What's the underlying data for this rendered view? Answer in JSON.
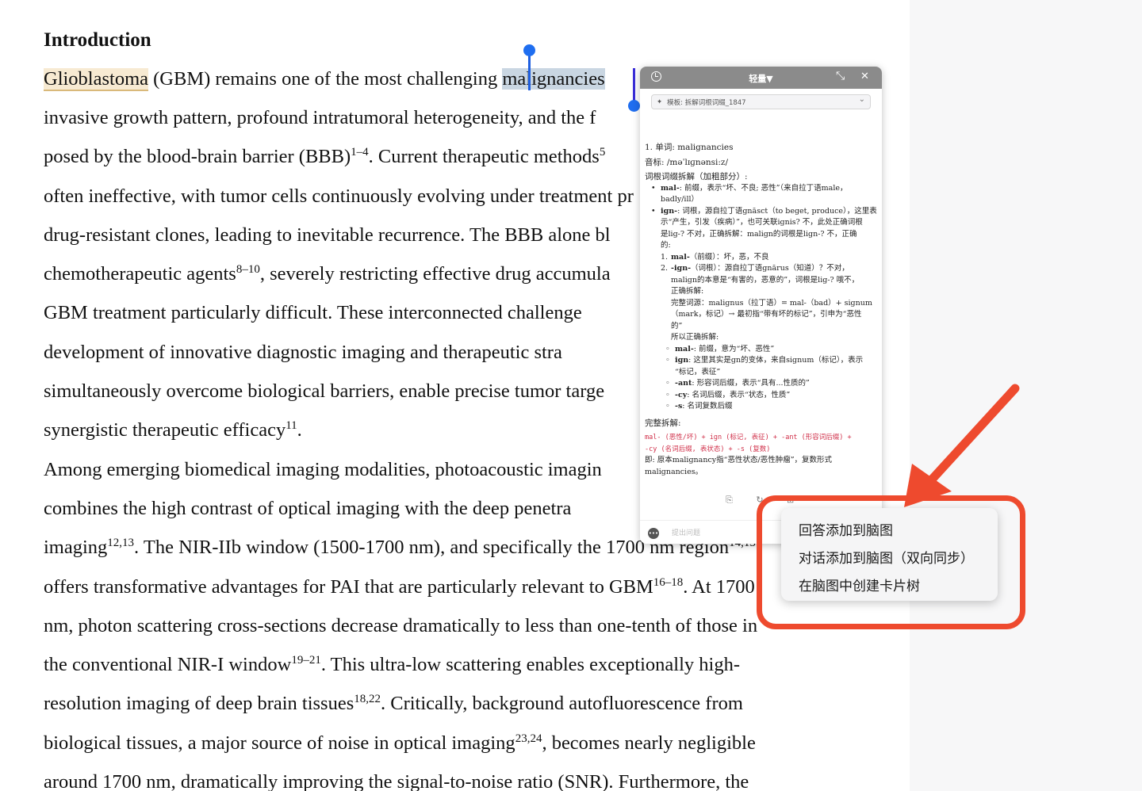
{
  "document": {
    "heading": "Introduction",
    "lines": [
      {
        "pre": "",
        "yellow": "Glioblastoma",
        "text": " (GBM) remains one of the most challenging ",
        "sel": "malignancies"
      },
      {
        "text": "invasive growth pattern, profound intratumoral heterogeneity, and the f"
      },
      {
        "text": "posed by the blood-brain barrier (BBB)",
        "sup": "1–4",
        "text2": ". Current therapeutic methods",
        "sup2": "5"
      },
      {
        "text": "often ineffective, with tumor cells continuously evolving under treatment pr"
      },
      {
        "text": "drug-resistant clones, leading to inevitable recurrence. The BBB alone bl"
      },
      {
        "text": "chemotherapeutic agents",
        "sup": "8–10",
        "text2": ", severely restricting effective drug accumula"
      },
      {
        "text": "GBM treatment particularly difficult. These interconnected challenge"
      },
      {
        "text": "development of innovative diagnostic imaging and therapeutic stra"
      },
      {
        "text": "simultaneously overcome biological barriers, enable precise tumor targe"
      },
      {
        "text": "synergistic therapeutic efficacy",
        "sup": "11",
        "text2": "."
      },
      {
        "text": "Among emerging biomedical imaging modalities, photoacoustic imagin"
      },
      {
        "text": "combines the high contrast of optical imaging with the deep penetra"
      },
      {
        "text": "imaging",
        "sup": "12,13",
        "text2": ". The NIR-IIb window (1500-1700 nm), and specifically the 1700 nm region",
        "sup2": "14,15"
      },
      {
        "text": "offers transformative advantages for PAI that are particularly relevant to GBM",
        "sup": "16–18",
        "text2": ". At 1700"
      },
      {
        "text": "nm, photon scattering cross-sections decrease dramatically to less than one-tenth of those in"
      },
      {
        "text": "the conventional NIR-I window",
        "sup": "19–21",
        "text2": ". This ultra-low scattering enables exceptionally high-"
      },
      {
        "text": "resolution imaging of deep brain tissues",
        "sup": "18,22",
        "text2": ". Critically, background autofluorescence from"
      },
      {
        "text": "biological tissues, a major source of noise in optical imaging",
        "sup": "23,24",
        "text2": ", becomes nearly negligible"
      },
      {
        "text": "around 1700 nm, dramatically improving the signal-to-noise ratio (SNR). Furthermore, the"
      }
    ]
  },
  "panel": {
    "title": "轻量▼",
    "template": "模板: 拆解词根词缀_1847",
    "word_line": "1. 单词:  malignancies",
    "phonetic": "音标:  /məˈlɪɡnənsi:z/",
    "section_title": "词根词缀拆解（加粗部分）:",
    "b1_head": "mal-",
    "b1_text": ": 前缀，表示“坏、不良; 恶性”（来自拉丁语male，",
    "b1_cont": "badly/ill）",
    "b2_head": "ign-",
    "b2_text": ": 词根，源自拉丁语gnāsct（to beget, produce），这里表",
    "b2_cont1": "示“产生，引发（疾病）”，也可关联ignis? 不，此处正确词根",
    "b2_cont2": "是lig-? 不对，正确拆解：malign的词根是lign-? 不，正确",
    "b2_cont3": "的:",
    "n1_head": "mal-",
    "n1_text": "（前缀）：坏，恶，不良",
    "n2_head": "-ign-",
    "n2_text": "（词根）：源自拉丁语gnārus（知道）？不对，",
    "n2_cont1": "malign的本意是“有害的，恶意的”，词根是lig-? 哦不，",
    "n2_cont2": "正确拆解:",
    "n2_cont3": "完整词源：malignus（拉丁语）= mal-（bad）+ signum",
    "n2_cont4": "（mark，标记）→ 最初指“带有坏的标记”，引申为“恶性",
    "n2_cont5": "的”",
    "n2_cont6": "所以正确拆解:",
    "s1_head": "mal-",
    "s1_text": ": 前缀，意为“坏、恶性”",
    "s2_head": "ign",
    "s2_text": ": 这里其实是gn的变体，来自signum（标记），表示",
    "s2_cont": "“标记，表征”",
    "s3_head": "-ant",
    "s3_text": ": 形容词后缀，表示“具有...性质的”",
    "s4_head": "-cy",
    "s4_text": ": 名词后缀，表示“状态，性质”",
    "s5_head": "-s",
    "s5_text": ": 名词复数后缀",
    "full_title": "完整拆解:",
    "code1": "mal- (恶性/坏)  + ign (标记, 表征)  + -ant (形容词后缀)  +",
    "code2": "-cy (名词后缀, 表状态)  + -s (复数)",
    "summary1": "即: 原本malignancy指“恶性状态/恶性肿瘤”，复数形式",
    "summary2": "malignancies。",
    "input_placeholder": "提出问题"
  },
  "context_menu": {
    "items": [
      "回答添加到脑图",
      "对话添加到脑图（双向同步）",
      "在脑图中创建卡片树"
    ]
  },
  "colors": {
    "annotation": "#ee4a2e",
    "selection": "#c9d6e2",
    "handle": "#1f6ef0"
  }
}
